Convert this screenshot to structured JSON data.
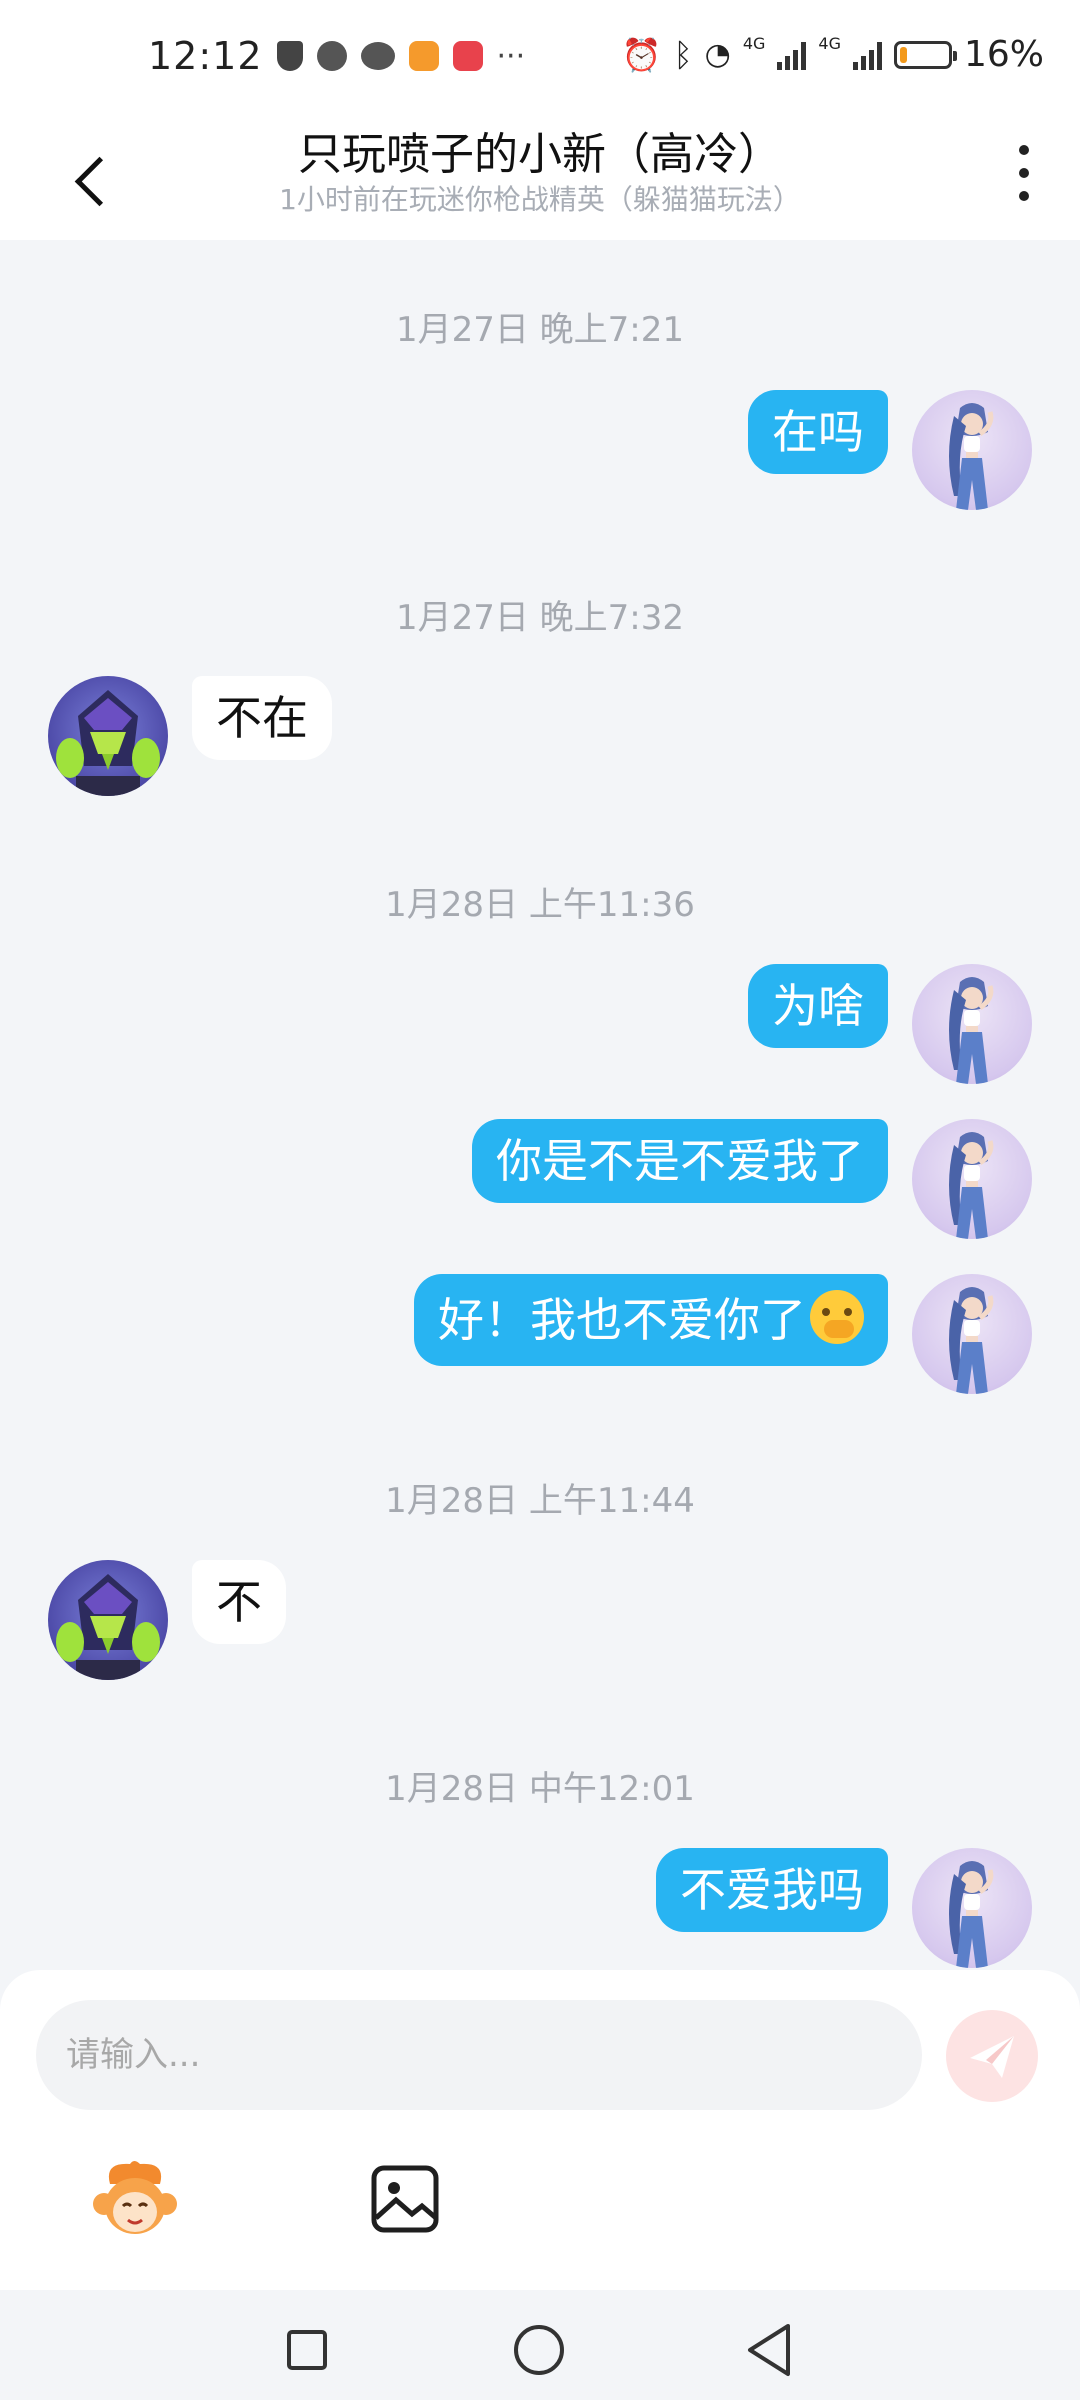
{
  "status_bar": {
    "time": "12:12",
    "network_1": "4G",
    "network_2": "4G",
    "battery": "16%",
    "battery_level": 0.16
  },
  "header": {
    "title": "只玩喷子的小新（高冷）",
    "subtitle": "1小时前在玩迷你枪战精英（躲猫猫玩法）"
  },
  "messages": [
    {
      "timestamp": "1月27日 晚上7:21"
    },
    {
      "sender": "me",
      "text": "在吗"
    },
    {
      "timestamp": "1月27日 晚上7:32"
    },
    {
      "sender": "other",
      "text": "不在"
    },
    {
      "timestamp": "1月28日 上午11:36"
    },
    {
      "sender": "me",
      "text": "为啥"
    },
    {
      "sender": "me",
      "text": "你是不是不爱我了"
    },
    {
      "sender": "me",
      "text": "好！我也不爱你了",
      "emoji": "hand-over-mouth-emoji"
    },
    {
      "timestamp": "1月28日 上午11:44"
    },
    {
      "sender": "other",
      "text": "不"
    },
    {
      "timestamp": "1月28日 中午12:01"
    },
    {
      "sender": "me",
      "text": "不爱我吗"
    }
  ],
  "composer": {
    "placeholder": "请输入..."
  },
  "colors": {
    "my_bubble": "#28b4f2",
    "their_bubble": "#ffffff",
    "background": "#f3f5f8",
    "send_button": "#fde3e3"
  },
  "icons": {
    "back": "chevron-left-icon",
    "more": "more-vertical-icon",
    "send": "paper-plane-icon",
    "emoji_tool": "monkey-face-icon",
    "image_tool": "image-icon"
  }
}
